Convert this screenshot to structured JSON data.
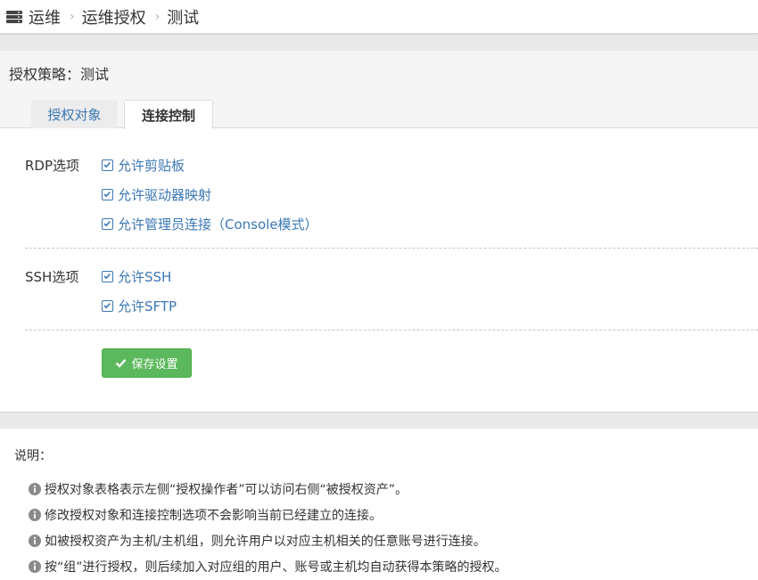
{
  "breadcrumb": {
    "icon": "server-icon",
    "items": [
      "运维",
      "运维授权",
      "测试"
    ]
  },
  "policy": {
    "title": "授权策略：测试"
  },
  "tabs": [
    {
      "label": "授权对象",
      "active": false
    },
    {
      "label": "连接控制",
      "active": true
    }
  ],
  "rdp": {
    "label": "RDP选项",
    "options": [
      {
        "label": "允许剪贴板",
        "checked": true
      },
      {
        "label": "允许驱动器映射",
        "checked": true
      },
      {
        "label": "允许管理员连接（Console模式）",
        "checked": true
      }
    ]
  },
  "ssh": {
    "label": "SSH选项",
    "options": [
      {
        "label": "允许SSH",
        "checked": true
      },
      {
        "label": "允许SFTP",
        "checked": true
      }
    ]
  },
  "actions": {
    "save_label": "保存设置"
  },
  "notes": {
    "title": "说明：",
    "items": [
      "授权对象表格表示左侧“授权操作者”可以访问右侧“被授权资产”。",
      "修改授权对象和连接控制选项不会影响当前已经建立的连接。",
      "如被授权资产为主机/主机组，则允许用户以对应主机相关的任意账号进行连接。",
      "按“组”进行授权，则后续加入对应组的用户、账号或主机均自动获得本策略的授权。"
    ]
  },
  "colors": {
    "link": "#3b78b5",
    "save_button": "#5cb85c",
    "info_icon": "#8a8a8a"
  }
}
